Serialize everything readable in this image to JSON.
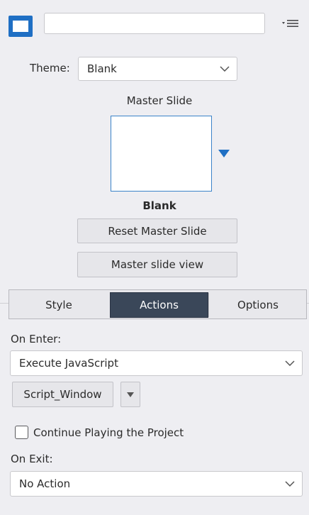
{
  "header": {
    "slide_name_value": "",
    "slide_icon": "slide-thumbnail-icon",
    "menu_icon": "panel-menu-icon"
  },
  "theme": {
    "label": "Theme:",
    "selected": "Blank"
  },
  "master_slide": {
    "title": "Master Slide",
    "name": "Blank",
    "reset_label": "Reset Master Slide",
    "view_label": "Master slide view"
  },
  "tabs": [
    {
      "label": "Style",
      "active": false
    },
    {
      "label": "Actions",
      "active": true
    },
    {
      "label": "Options",
      "active": false
    }
  ],
  "actions": {
    "on_enter_label": "On Enter:",
    "on_enter_value": "Execute JavaScript",
    "script_button_label": "Script_Window",
    "continue_label": "Continue Playing the Project",
    "continue_checked": false,
    "on_exit_label": "On Exit:",
    "on_exit_value": "No Action"
  },
  "colors": {
    "accent": "#1f6fc4",
    "active_tab_bg": "#3a4759",
    "panel_bg": "#eeeef2"
  }
}
